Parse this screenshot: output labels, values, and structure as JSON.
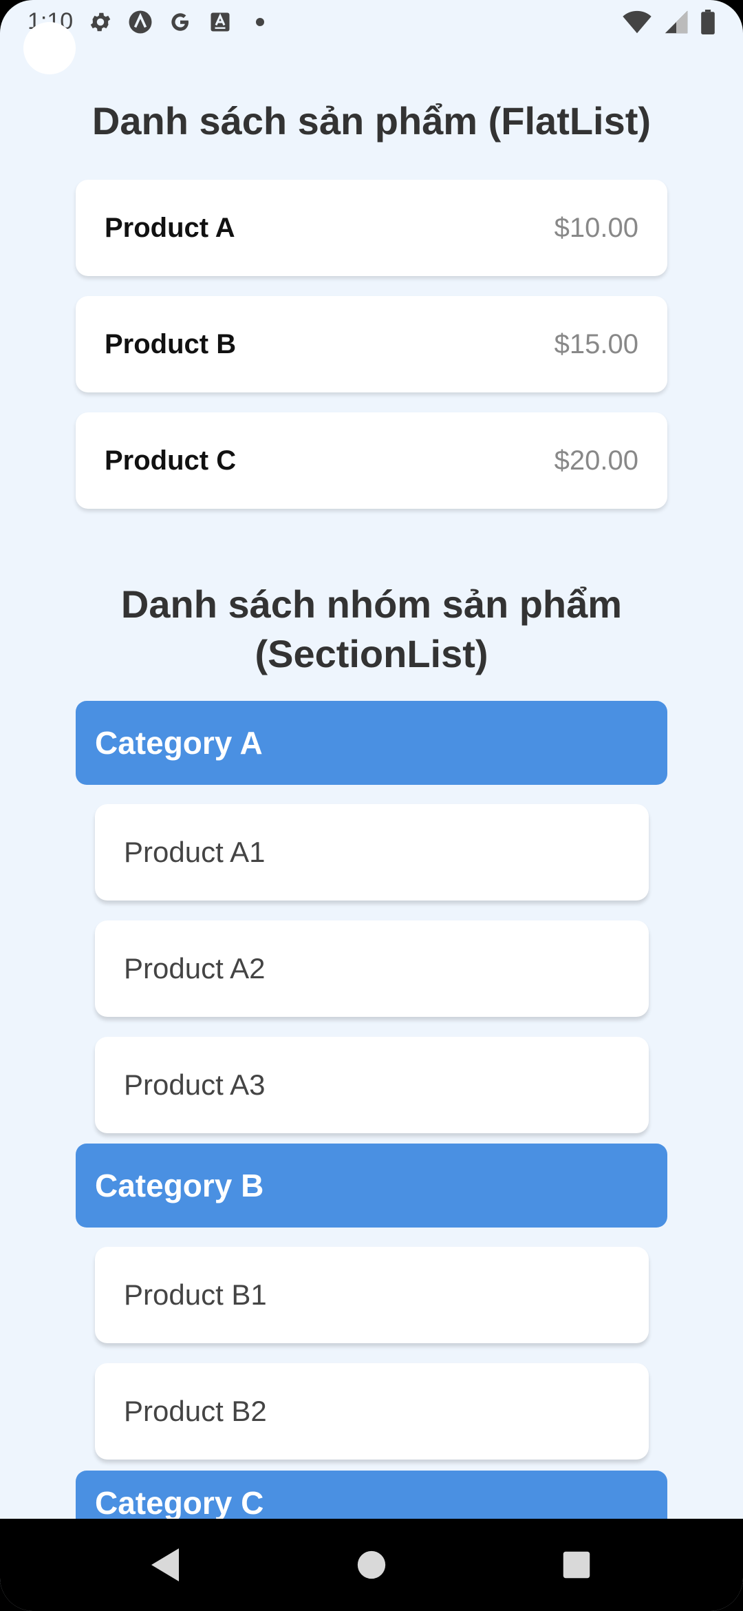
{
  "status_bar": {
    "time": "1:10",
    "icons": [
      "gear-icon",
      "a-logo-icon",
      "google-icon",
      "keyboard-icon",
      "dot-icon"
    ],
    "right_icons": [
      "wifi-icon",
      "signal-icon",
      "battery-icon"
    ]
  },
  "flat_list": {
    "title": "Danh sách sản phẩm (FlatList)",
    "items": [
      {
        "name": "Product A",
        "price": "$10.00"
      },
      {
        "name": "Product B",
        "price": "$15.00"
      },
      {
        "name": "Product C",
        "price": "$20.00"
      }
    ]
  },
  "section_list": {
    "title": "Danh sách nhóm sản phẩm (SectionList)",
    "sections": [
      {
        "title": "Category A",
        "items": [
          "Product A1",
          "Product A2",
          "Product A3"
        ]
      },
      {
        "title": "Category B",
        "items": [
          "Product B1",
          "Product B2"
        ]
      },
      {
        "title": "Category C",
        "items": []
      }
    ]
  },
  "nav_bar": {
    "buttons": [
      "back-icon",
      "home-icon",
      "recents-icon"
    ]
  },
  "colors": {
    "background": "#EEF5FD",
    "category_header": "#4A90E2",
    "card": "#FFFFFF",
    "price_text": "#888888"
  }
}
